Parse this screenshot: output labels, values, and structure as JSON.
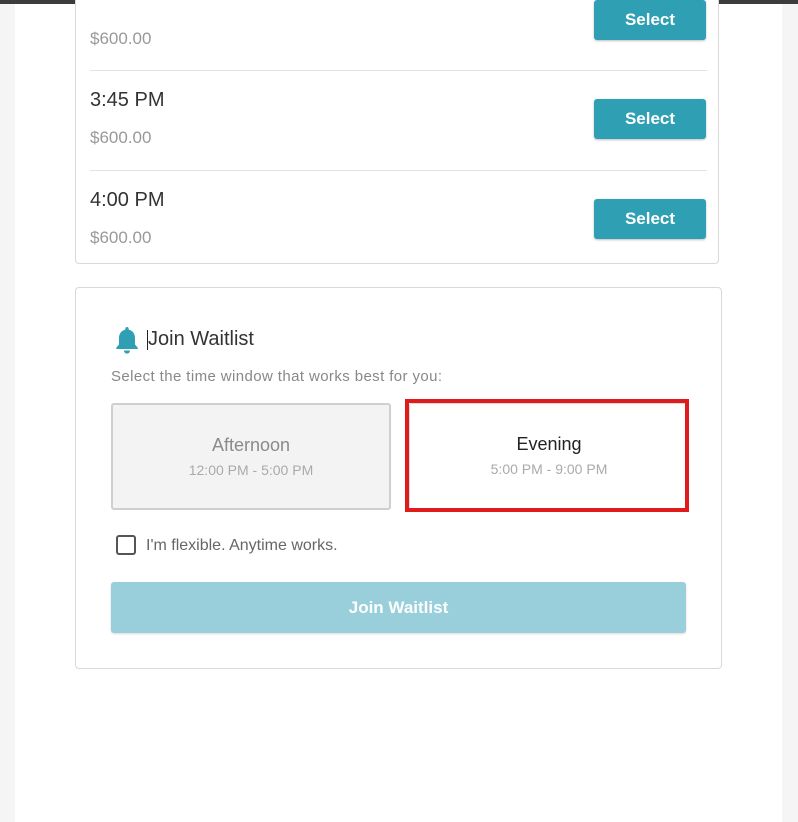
{
  "slots": [
    {
      "time": "",
      "price": "$600.00",
      "button": "Select"
    },
    {
      "time": "3:45 PM",
      "price": "$600.00",
      "button": "Select"
    },
    {
      "time": "4:00 PM",
      "price": "$600.00",
      "button": "Select"
    }
  ],
  "waitlist": {
    "icon": "bell-icon",
    "title": "Join Waitlist",
    "subtitle": "Select the time window that works best for you:",
    "windows": [
      {
        "label": "Afternoon",
        "range": "12:00 PM - 5:00 PM",
        "state": "disabled"
      },
      {
        "label": "Evening",
        "range": "5:00 PM - 9:00 PM",
        "state": "highlighted"
      }
    ],
    "flexible_label": "I'm flexible. Anytime works.",
    "flexible_checked": false,
    "submit_label": "Join Waitlist"
  },
  "colors": {
    "accent": "#2f9fb3",
    "accent_disabled": "#99cfdb",
    "highlight": "#e01b1b"
  }
}
